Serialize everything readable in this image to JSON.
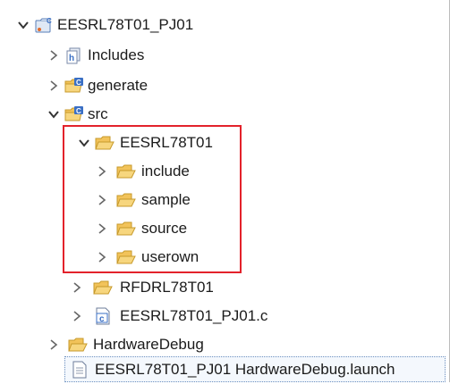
{
  "tree": {
    "project": {
      "label": "EESRL78T01_PJ01",
      "icon": "c-project-icon",
      "expanded": true
    },
    "includes": {
      "label": "Includes",
      "icon": "includes-icon",
      "expanded": false
    },
    "generate": {
      "label": "generate",
      "icon": "source-folder-icon",
      "expanded": false
    },
    "src": {
      "label": "src",
      "icon": "source-folder-icon",
      "expanded": true
    },
    "eesrl": {
      "label": "EESRL78T01",
      "icon": "folder-open-icon",
      "expanded": true,
      "children": [
        {
          "label": "include",
          "icon": "folder-icon"
        },
        {
          "label": "sample",
          "icon": "folder-icon"
        },
        {
          "label": "source",
          "icon": "folder-icon"
        },
        {
          "label": "userown",
          "icon": "folder-icon"
        }
      ]
    },
    "rfdrl": {
      "label": "RFDRL78T01",
      "icon": "folder-icon",
      "expanded": false
    },
    "cfile": {
      "label": "EESRL78T01_PJ01.c",
      "icon": "c-file-icon",
      "expanded": false
    },
    "hwdebug": {
      "label": "HardwareDebug",
      "icon": "folder-icon",
      "expanded": false
    },
    "launch": {
      "label": "EESRL78T01_PJ01 HardwareDebug.launch",
      "icon": "launch-file-icon"
    }
  },
  "colors": {
    "highlight": "#e3222b",
    "folder": "#f2c35a",
    "folder_border": "#c79a2b",
    "source_blue": "#3a6fc4"
  }
}
